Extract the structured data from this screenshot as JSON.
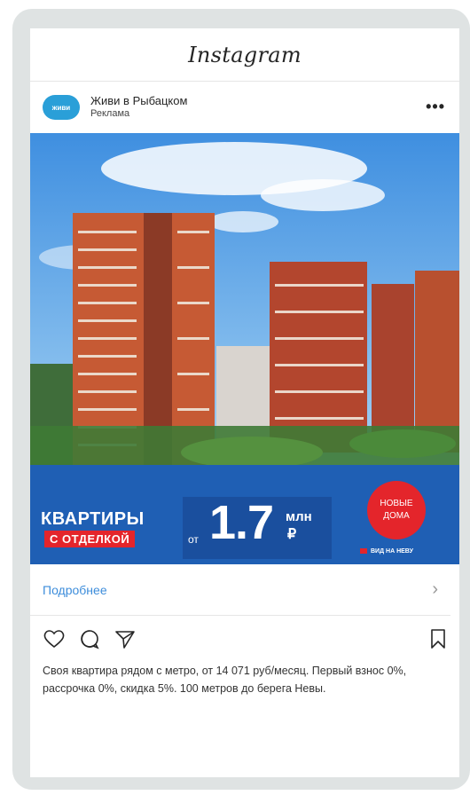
{
  "app": {
    "title": "Instagram"
  },
  "post": {
    "account_name": "Живи в Рыбацком",
    "account_subtitle": "Реклама",
    "avatar_text": "живи",
    "more_menu": "•••"
  },
  "ad": {
    "line1": "КВАРТИРЫ",
    "line2": "С ОТДЕЛКОЙ",
    "price_prefix": "от",
    "price": "1.7",
    "price_unit": "млн",
    "currency": "₽",
    "circle_text_1": "НОВЫЕ",
    "circle_text_2": "ДОМА",
    "badge": "ВИД НА НЕВУ"
  },
  "cta": {
    "label": "Подробнее",
    "chevron": "›"
  },
  "icons": [
    "heart-icon",
    "comment-icon",
    "share-icon",
    "bookmark-icon"
  ],
  "caption": "Своя квартира рядом с метро, от 14 071 руб/месяц. Первый взнос 0%, рассрочка 0%, скидка 5%. 100 метров до берега Невы.",
  "colors": {
    "link": "#3d8ddb",
    "banner": "#1f5fb4",
    "accent_red": "#e4252b"
  }
}
